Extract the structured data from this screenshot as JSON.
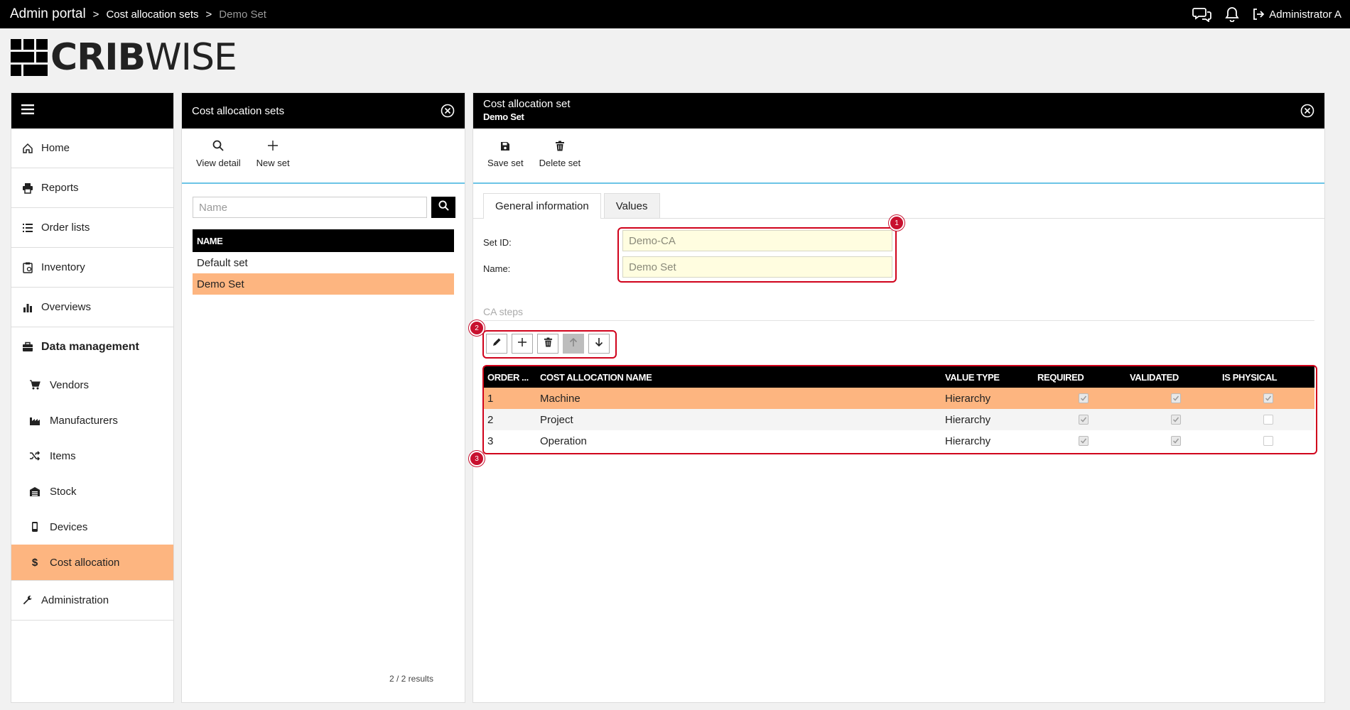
{
  "breadcrumb": {
    "root": "Admin portal",
    "separator": ">",
    "level1": "Cost allocation sets",
    "current": "Demo Set"
  },
  "topbar": {
    "user": "Administrator A",
    "icons": [
      "chat-icon",
      "bell-icon",
      "logout-icon"
    ]
  },
  "logo": {
    "bold": "CRIB",
    "light": "WISE"
  },
  "sidebar": {
    "items": [
      {
        "label": "Home",
        "icon": "home-icon"
      },
      {
        "label": "Reports",
        "icon": "printer-icon"
      },
      {
        "label": "Order lists",
        "icon": "list-icon"
      },
      {
        "label": "Inventory",
        "icon": "clipboard-icon"
      },
      {
        "label": "Overviews",
        "icon": "bar-chart-icon"
      }
    ],
    "data_management": {
      "label": "Data management",
      "sub": [
        {
          "label": "Vendors",
          "icon": "cart-icon"
        },
        {
          "label": "Manufacturers",
          "icon": "factory-icon"
        },
        {
          "label": "Items",
          "icon": "shuffle-icon"
        },
        {
          "label": "Stock",
          "icon": "warehouse-icon"
        },
        {
          "label": "Devices",
          "icon": "mobile-icon"
        },
        {
          "label": "Cost allocation",
          "icon": "dollar-icon",
          "active": true
        }
      ]
    },
    "administration": {
      "label": "Administration",
      "icon": "wrench-icon"
    }
  },
  "list_panel": {
    "title": "Cost allocation sets",
    "tools": {
      "view_detail": "View detail",
      "new_set": "New set"
    },
    "search_placeholder": "Name",
    "column_header": "NAME",
    "rows": [
      {
        "name": "Default set",
        "selected": false
      },
      {
        "name": "Demo Set",
        "selected": true
      }
    ],
    "results": "2 / 2 results"
  },
  "detail_panel": {
    "title": "Cost allocation set",
    "subtitle": "Demo Set",
    "tools": {
      "save": "Save set",
      "delete": "Delete set"
    },
    "tabs": [
      {
        "label": "General information",
        "active": true
      },
      {
        "label": "Values",
        "active": false
      }
    ],
    "form": {
      "set_id_label": "Set ID:",
      "set_id_value": "Demo-CA",
      "name_label": "Name:",
      "name_value": "Demo Set"
    },
    "ca_steps_label": "CA steps",
    "annotations": [
      "1",
      "2",
      "3"
    ],
    "grid": {
      "headers": {
        "order": "ORDER ...",
        "name": "COST ALLOCATION NAME",
        "value_type": "VALUE TYPE",
        "required": "REQUIRED",
        "validated": "VALIDATED",
        "is_physical": "IS PHYSICAL"
      },
      "rows": [
        {
          "order": "1",
          "name": "Machine",
          "value_type": "Hierarchy",
          "required": true,
          "validated": true,
          "is_physical": true
        },
        {
          "order": "2",
          "name": "Project",
          "value_type": "Hierarchy",
          "required": true,
          "validated": true,
          "is_physical": false
        },
        {
          "order": "3",
          "name": "Operation",
          "value_type": "Hierarchy",
          "required": true,
          "validated": true,
          "is_physical": false
        }
      ]
    }
  },
  "colors": {
    "accent": "#fdb580",
    "divider": "#6cc4e6",
    "annotation": "#c8102e",
    "field_bg": "#fffde0"
  }
}
